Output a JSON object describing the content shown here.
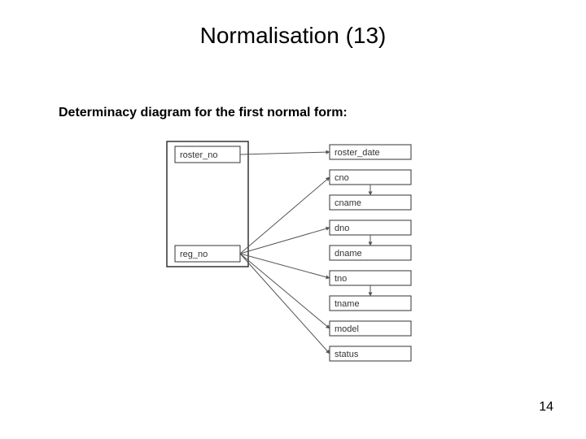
{
  "title": "Normalisation (13)",
  "subtitle": "Determinacy diagram for the first normal form:",
  "page_number": "14",
  "diagram": {
    "keys": [
      "roster_no",
      "reg_no"
    ],
    "attrs": [
      "roster_date",
      "cno",
      "cname",
      "dno",
      "dname",
      "tno",
      "tname",
      "model",
      "status"
    ],
    "edges": [
      {
        "from_key": 0,
        "to_attr": 0
      },
      {
        "from_key": 1,
        "to_attr": 1
      },
      {
        "from_key": 1,
        "to_attr": 2,
        "via_attr": 1
      },
      {
        "from_key": 1,
        "to_attr": 3
      },
      {
        "from_key": 1,
        "to_attr": 4,
        "via_attr": 3
      },
      {
        "from_key": 1,
        "to_attr": 5
      },
      {
        "from_key": 1,
        "to_attr": 6,
        "via_attr": 5
      },
      {
        "from_key": 1,
        "to_attr": 7
      },
      {
        "from_key": 1,
        "to_attr": 8
      }
    ]
  }
}
